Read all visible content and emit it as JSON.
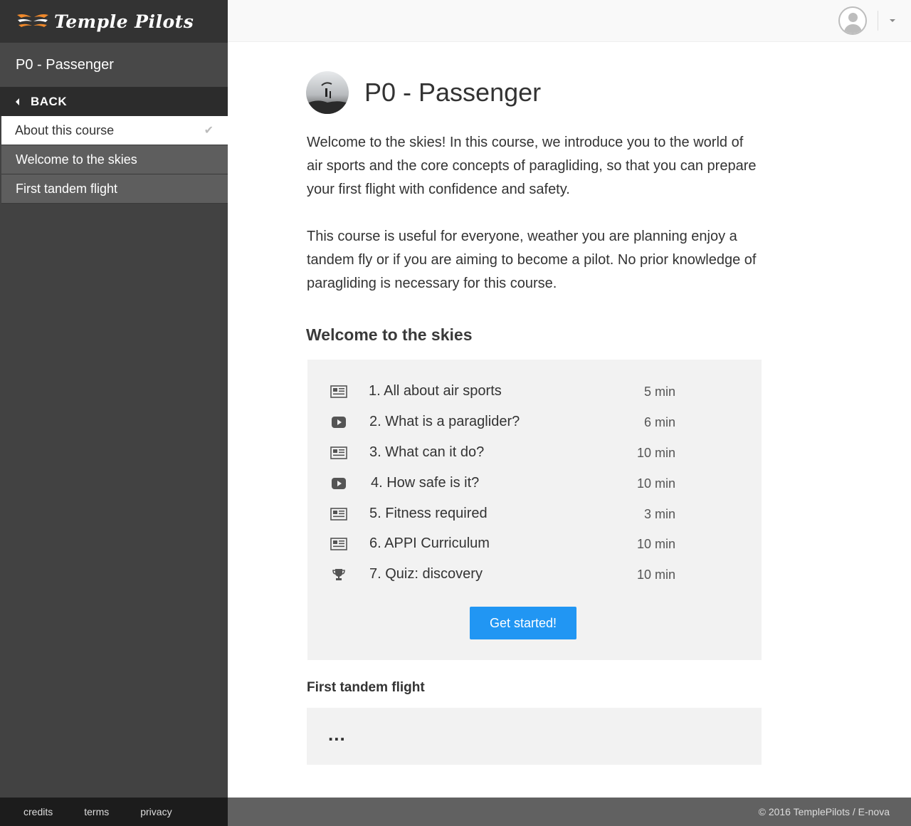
{
  "brand": {
    "name": "Temple Pilots"
  },
  "sidebar": {
    "course_title": "P0 - Passenger",
    "back_label": "BACK",
    "items": [
      {
        "label": "About this course",
        "active": true
      },
      {
        "label": "Welcome to the skies",
        "active": false
      },
      {
        "label": "First tandem flight",
        "active": false
      }
    ],
    "footer_links": [
      "credits",
      "terms",
      "privacy"
    ]
  },
  "main": {
    "title": "P0 - Passenger",
    "intro_1": "Welcome to the skies! In this course, we introduce you to the world of air sports and the core concepts of paragliding, so that you can prepare your first flight with confidence and safety.",
    "intro_2": "This course is useful for everyone, weather you are planning enjoy a tandem fly or if you are aiming to become a pilot. No prior knowledge of paragliding is necessary for this course.",
    "section_1_title": "Welcome to the skies",
    "lessons": [
      {
        "title": "1. All about air sports",
        "duration": "5 min",
        "icon": "article-icon"
      },
      {
        "title": "2. What is a paraglider?",
        "duration": "6 min",
        "icon": "video-icon"
      },
      {
        "title": "3. What can it do?",
        "duration": "10 min",
        "icon": "article-icon"
      },
      {
        "title": "4. How safe is it?",
        "duration": "10 min",
        "icon": "video-icon"
      },
      {
        "title": "5. Fitness required",
        "duration": "3 min",
        "icon": "article-icon"
      },
      {
        "title": "6. APPI Curriculum",
        "duration": "10 min",
        "icon": "article-icon"
      },
      {
        "title": "7. Quiz: discovery",
        "duration": "10 min",
        "icon": "trophy-icon"
      }
    ],
    "cta_label": "Get started!",
    "section_2_title": "First tandem flight",
    "section_2_placeholder": "..."
  },
  "footer": {
    "copyright": "© 2016 TemplePilots / E-nova"
  },
  "colors": {
    "accent": "#2196f3",
    "sidebar_bg": "#424242",
    "logo_orange": "#f0892b"
  }
}
